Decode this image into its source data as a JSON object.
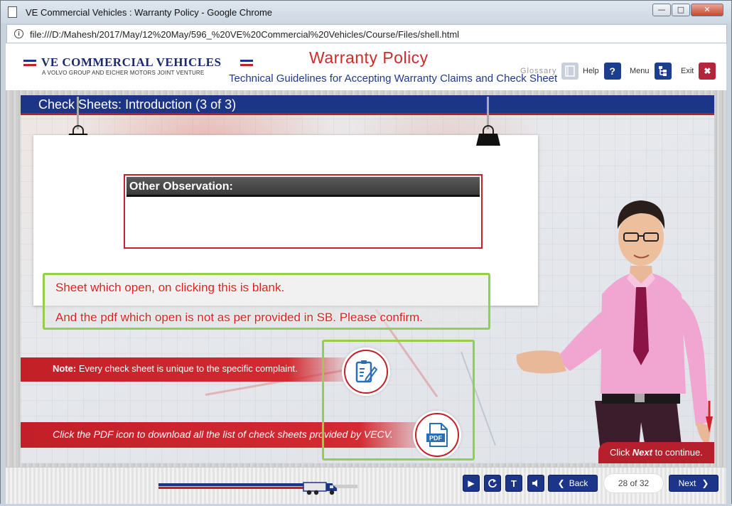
{
  "window": {
    "title": "VE Commercial Vehicles : Warranty Policy - Google Chrome",
    "url": "file:///D:/Mahesh/2017/May/12%20May/596_%20VE%20Commercial%20Vehicles/Course/Files/shell.html"
  },
  "header": {
    "brand": "VE COMMERCIAL VEHICLES",
    "tagline": "A VOLVO GROUP AND EICHER MOTORS JOINT VENTURE",
    "course_title": "Warranty Policy",
    "course_subtitle": "Technical Guidelines for Accepting Warranty Claims and Check Sheet",
    "glossary_label": "Glossary",
    "help_label": "Help",
    "menu_label": "Menu",
    "exit_label": "Exit"
  },
  "slide": {
    "title": "Check Sheets: Introduction (3 of 3)",
    "observation_label": "Other Observation:",
    "annotation_line1": "Sheet which open, on clicking this is blank.",
    "annotation_line2": "And the pdf which open is not as per provided in SB. Please confirm.",
    "note_prefix": "Note:",
    "note_text": " Every check sheet is unique to the specific complaint.",
    "pdf_instruction": "Click the PDF icon to download all the list of check sheets provided by VECV.",
    "pdf_icon_label": "PDF",
    "next_hint_prefix": "Click ",
    "next_hint_emphasis": "Next",
    "next_hint_suffix": " to continue."
  },
  "footer": {
    "back_label": "Back",
    "next_label": "Next",
    "page_counter": "28 of 32",
    "progress_fraction": 0.875
  },
  "colors": {
    "brand_blue": "#1d3589",
    "brand_red": "#c21f28",
    "annotation_green": "#93d04a",
    "annotation_text": "#e21d1d"
  }
}
